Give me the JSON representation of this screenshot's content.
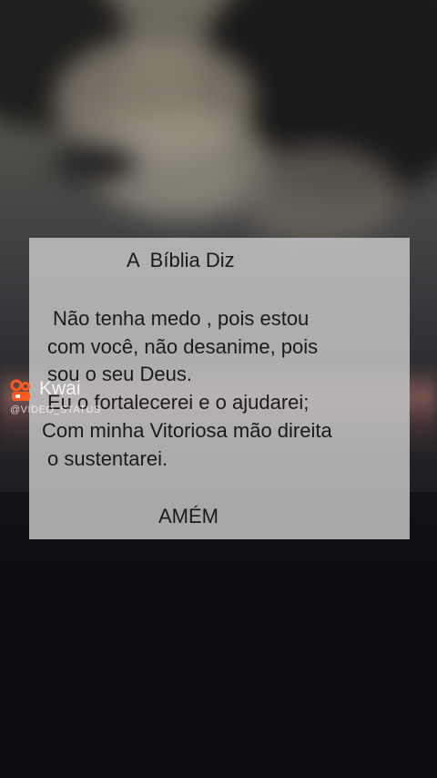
{
  "panel": {
    "title": "A  Bíblia Diz",
    "lines": [
      "Não tenha medo , pois estou",
      "com você, não desanime, pois",
      "sou o seu Deus.",
      "Eu o fortalecerei e o ajudarei;",
      "Com minha Vitoriosa mão direita",
      "o sustentarei."
    ],
    "closing": "AMÉM"
  },
  "watermark": {
    "brand": "Kwai",
    "handle": "@VIDEO_STATUS",
    "logo_icon": "kwai-logo-icon",
    "brand_color": "#ff5a1f"
  }
}
